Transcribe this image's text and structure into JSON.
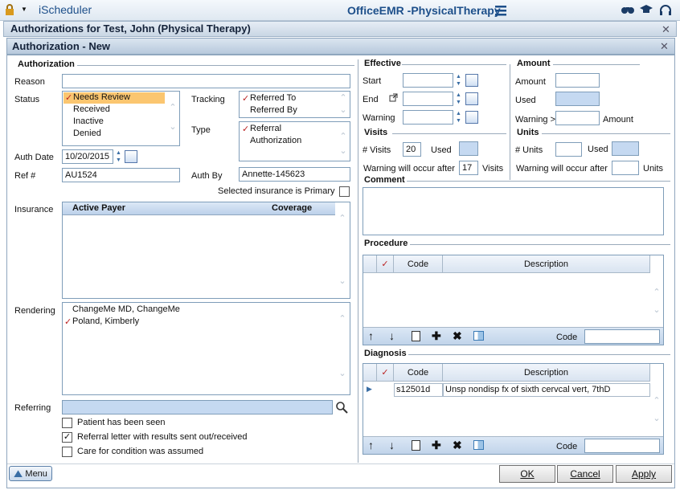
{
  "topbar": {
    "app_name": "iScheduler",
    "emr_title": "OfficeEMR -PhysicalTherapy",
    "lock_icon": "lock-icon",
    "menu_icon": "hamburger-icon"
  },
  "window": {
    "title": "Authorizations for Test, John (Physical Therapy)",
    "close": "✕"
  },
  "dialog": {
    "title": "Authorization - New",
    "close": "✕"
  },
  "auth": {
    "section": "Authorization",
    "reason_label": "Reason",
    "reason_value": "",
    "status_label": "Status",
    "status_options": [
      "Needs Review",
      "Received",
      "Inactive",
      "Denied"
    ],
    "tracking_label": "Tracking",
    "tracking_options": [
      "Referred To",
      "Referred By"
    ],
    "type_label": "Type",
    "type_options": [
      "Referral",
      "Authorization"
    ],
    "auth_date_label": "Auth Date",
    "auth_date_value": "10/20/2015",
    "ref_label": "Ref #",
    "ref_value": "AU1524",
    "auth_by_label": "Auth By",
    "auth_by_value": "Annette-145623",
    "primary_label": "Selected insurance is Primary",
    "insurance_label": "Insurance",
    "insurance_col_payer": "Active Payer",
    "insurance_col_coverage": "Coverage",
    "rendering_label": "Rendering",
    "rendering_items": [
      "ChangeMe MD, ChangeMe",
      "Poland, Kimberly"
    ],
    "referring_label": "Referring",
    "referring_value": "",
    "seen_label": "Patient has been seen",
    "letter_label": "Referral letter with results sent out/received",
    "care_label": "Care for condition was assumed"
  },
  "effective": {
    "section": "Effective",
    "start_label": "Start",
    "end_label": "End",
    "warning_label": "Warning"
  },
  "amount": {
    "section": "Amount",
    "amount_label": "Amount",
    "used_label": "Used",
    "warning_label": "Warning >",
    "warning_unit": "Amount"
  },
  "visits": {
    "section": "Visits",
    "count_label": "# Visits",
    "count_value": "20",
    "used_label": "Used",
    "warn_label": "Warning will occur after",
    "warn_value": "17",
    "warn_unit": "Visits"
  },
  "units": {
    "section": "Units",
    "count_label": "# Units",
    "used_label": "Used",
    "warn_label": "Warning will occur after",
    "warn_unit": "Units"
  },
  "comment": {
    "section": "Comment"
  },
  "procedure": {
    "section": "Procedure",
    "col_code": "Code",
    "col_desc": "Description",
    "code_label": "Code"
  },
  "diagnosis": {
    "section": "Diagnosis",
    "col_code": "Code",
    "col_desc": "Description",
    "code_label": "Code",
    "rows": [
      {
        "code": "s12501d",
        "desc": "Unsp nondisp fx of sixth cervcal vert, 7thD"
      }
    ]
  },
  "footer": {
    "menu": "Menu",
    "ok": "OK",
    "cancel": "Cancel",
    "apply": "Apply"
  },
  "glyphs": {
    "check": "✓",
    "up": "⌃",
    "down": "⌄",
    "spin_up": "▲",
    "spin_down": "▼",
    "arrow_up": "↑",
    "arrow_down": "↓",
    "plus": "✚",
    "delete": "✖",
    "search": "⚲",
    "row_marker": "▶"
  }
}
